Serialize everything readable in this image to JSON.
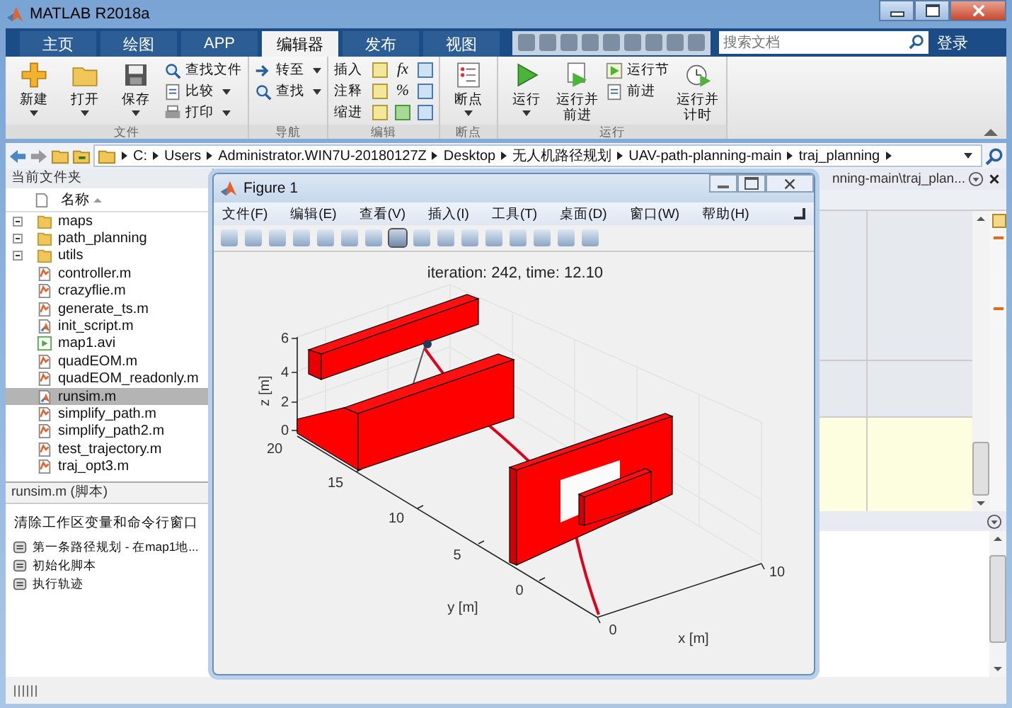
{
  "window": {
    "title": "MATLAB R2018a"
  },
  "tabs": [
    {
      "label": "主页",
      "selected": false
    },
    {
      "label": "绘图",
      "selected": false
    },
    {
      "label": "APP",
      "selected": false
    },
    {
      "label": "编辑器",
      "selected": true
    },
    {
      "label": "发布",
      "selected": false
    },
    {
      "label": "视图",
      "selected": false
    }
  ],
  "search": {
    "placeholder": "搜索文档"
  },
  "login": "登录",
  "ribbon": {
    "groups": [
      {
        "label": "文件",
        "kind": "file",
        "large": [
          {
            "label": "新建",
            "dropdown": true
          },
          {
            "label": "打开",
            "dropdown": true
          },
          {
            "label": "保存",
            "dropdown": true
          }
        ],
        "small": [
          {
            "label": "查找文件",
            "dropdown": false
          },
          {
            "label": "比较",
            "dropdown": true
          },
          {
            "label": "打印",
            "dropdown": true
          }
        ]
      },
      {
        "label": "导航",
        "kind": "nav",
        "small": [
          {
            "label": "转至",
            "dropdown": true
          },
          {
            "label": "查找",
            "dropdown": true
          }
        ]
      },
      {
        "label": "编辑",
        "kind": "edit",
        "rows": [
          {
            "label": "插入",
            "symbol": "fx"
          },
          {
            "label": "注释",
            "symbol": "%"
          },
          {
            "label": "缩进"
          }
        ]
      },
      {
        "label": "断点",
        "kind": "break",
        "large": [
          {
            "label": "断点",
            "dropdown": true
          }
        ]
      },
      {
        "label": "运行",
        "kind": "run",
        "large": [
          {
            "label": "运行",
            "dropdown": true
          },
          {
            "label": "运行并前进",
            "dropdown": false
          }
        ],
        "small": [
          {
            "label": "运行节",
            "dropdown": false
          },
          {
            "label": "前进",
            "dropdown": false
          }
        ],
        "after": [
          {
            "label": "运行并计时",
            "dropdown": false
          }
        ]
      }
    ]
  },
  "address": [
    "C:",
    "Users",
    "Administrator.WIN7U-20180127Z",
    "Desktop",
    "无人机路径规划",
    "UAV-path-planning-main",
    "traj_planning"
  ],
  "folder_panel": {
    "title": "当前文件夹",
    "column": "名称",
    "files": [
      {
        "name": "maps",
        "kind": "folder",
        "selected": false
      },
      {
        "name": "path_planning",
        "kind": "folder",
        "selected": false
      },
      {
        "name": "utils",
        "kind": "folder",
        "selected": false
      },
      {
        "name": "controller.m",
        "kind": "function",
        "selected": false
      },
      {
        "name": "crazyflie.m",
        "kind": "function",
        "selected": false
      },
      {
        "name": "generate_ts.m",
        "kind": "function",
        "selected": false
      },
      {
        "name": "init_script.m",
        "kind": "script",
        "selected": false
      },
      {
        "name": "map1.avi",
        "kind": "video",
        "selected": false
      },
      {
        "name": "quadEOM.m",
        "kind": "function",
        "selected": false
      },
      {
        "name": "quadEOM_readonly.m",
        "kind": "function",
        "selected": false
      },
      {
        "name": "runsim.m",
        "kind": "script",
        "selected": true
      },
      {
        "name": "simplify_path.m",
        "kind": "function",
        "selected": false
      },
      {
        "name": "simplify_path2.m",
        "kind": "function",
        "selected": false
      },
      {
        "name": "test_trajectory.m",
        "kind": "function",
        "selected": false
      },
      {
        "name": "traj_opt3.m",
        "kind": "function",
        "selected": false
      }
    ]
  },
  "details": {
    "file": "runsim.m",
    "type": "(脚本)",
    "description": "清除工作区变量和命令行窗口",
    "sections": [
      "第一条路径规划 - 在map1地...",
      "初始化脚本",
      "执行轨迹"
    ]
  },
  "editor": {
    "tab": "nning-main\\traj_plan..."
  },
  "figure": {
    "title": "Figure 1",
    "menu": [
      "文件(F)",
      "编辑(E)",
      "查看(V)",
      "插入(I)",
      "工具(T)",
      "桌面(D)",
      "窗口(W)",
      "帮助(H)"
    ],
    "plot": {
      "title": "iteration: 242, time: 12.10",
      "xlabel": "x [m]",
      "ylabel": "y [m]",
      "zlabel": "z [m]",
      "zticks": [
        "6",
        "4",
        "2",
        "0"
      ],
      "yticks": [
        "20",
        "15",
        "10",
        "5",
        "0"
      ],
      "xticks": [
        "0",
        "10"
      ]
    }
  }
}
